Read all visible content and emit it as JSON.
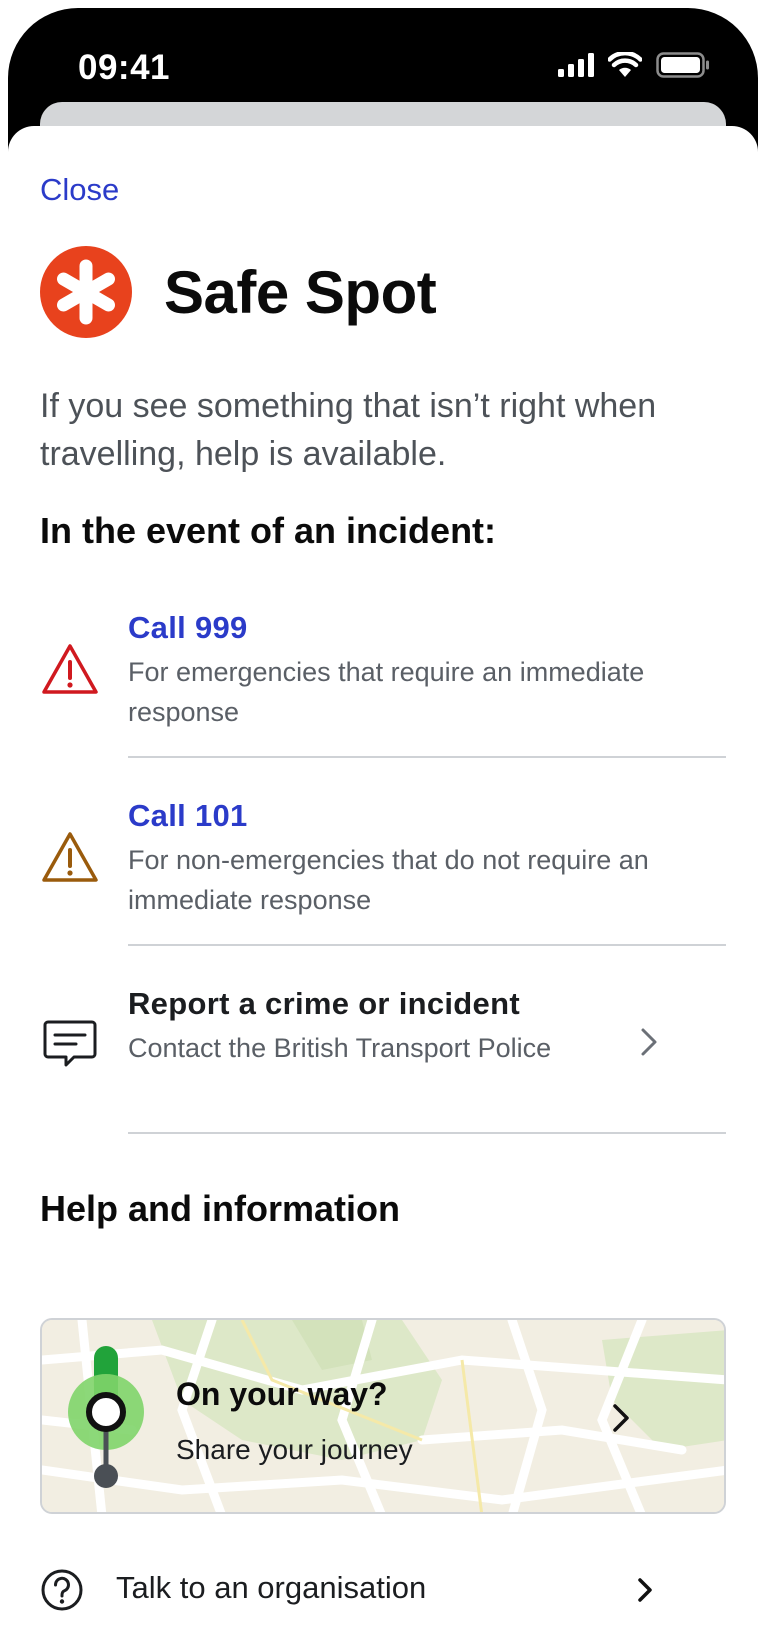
{
  "status_bar": {
    "time": "09:41",
    "icons": [
      "cellular-signal-icon",
      "wifi-icon",
      "battery-icon"
    ]
  },
  "header": {
    "close_label": "Close",
    "title": "Safe Spot",
    "logo_icon": "asterisk-logo-icon"
  },
  "intro_text": "If you see something that isn’t right when travelling, help is available.",
  "incident_section": {
    "heading": "In the event of an incident:",
    "items": [
      {
        "icon": "warning-triangle-icon",
        "title": "Call 999",
        "description": "For emergencies that require an immediate response"
      },
      {
        "icon": "warning-triangle-icon",
        "title": "Call 101",
        "description": "For non-emergencies that do not require an immediate response"
      },
      {
        "icon": "message-icon",
        "title": "Report a crime or incident",
        "description": "Contact the British Transport Police"
      }
    ]
  },
  "help_section": {
    "heading": "Help and information",
    "journey_card": {
      "title": "On your way?",
      "subtitle": "Share your journey"
    },
    "org_item": {
      "label": "Talk to an organisation",
      "icon": "question-circle-icon"
    }
  },
  "colors": {
    "link_blue": "#2b3bc9",
    "brand_red": "#e8421d",
    "emergency_red": "#d0191f",
    "warning_brown": "#9a5b0c",
    "route_green": "#21a33a"
  }
}
